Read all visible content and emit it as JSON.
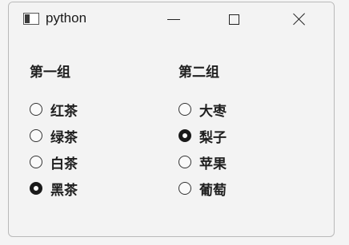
{
  "window": {
    "title": "python"
  },
  "icons": {
    "app": "python-window-icon",
    "minimize": "minimize-icon",
    "maximize": "maximize-icon",
    "close": "close-icon"
  },
  "groups": [
    {
      "label": "第一组",
      "options": [
        {
          "label": "红茶",
          "checked": false
        },
        {
          "label": "绿茶",
          "checked": false
        },
        {
          "label": "白茶",
          "checked": false
        },
        {
          "label": "黑茶",
          "checked": true
        }
      ]
    },
    {
      "label": "第二组",
      "options": [
        {
          "label": "大枣",
          "checked": false
        },
        {
          "label": "梨子",
          "checked": true
        },
        {
          "label": "苹果",
          "checked": false
        },
        {
          "label": "葡萄",
          "checked": false
        }
      ]
    }
  ]
}
